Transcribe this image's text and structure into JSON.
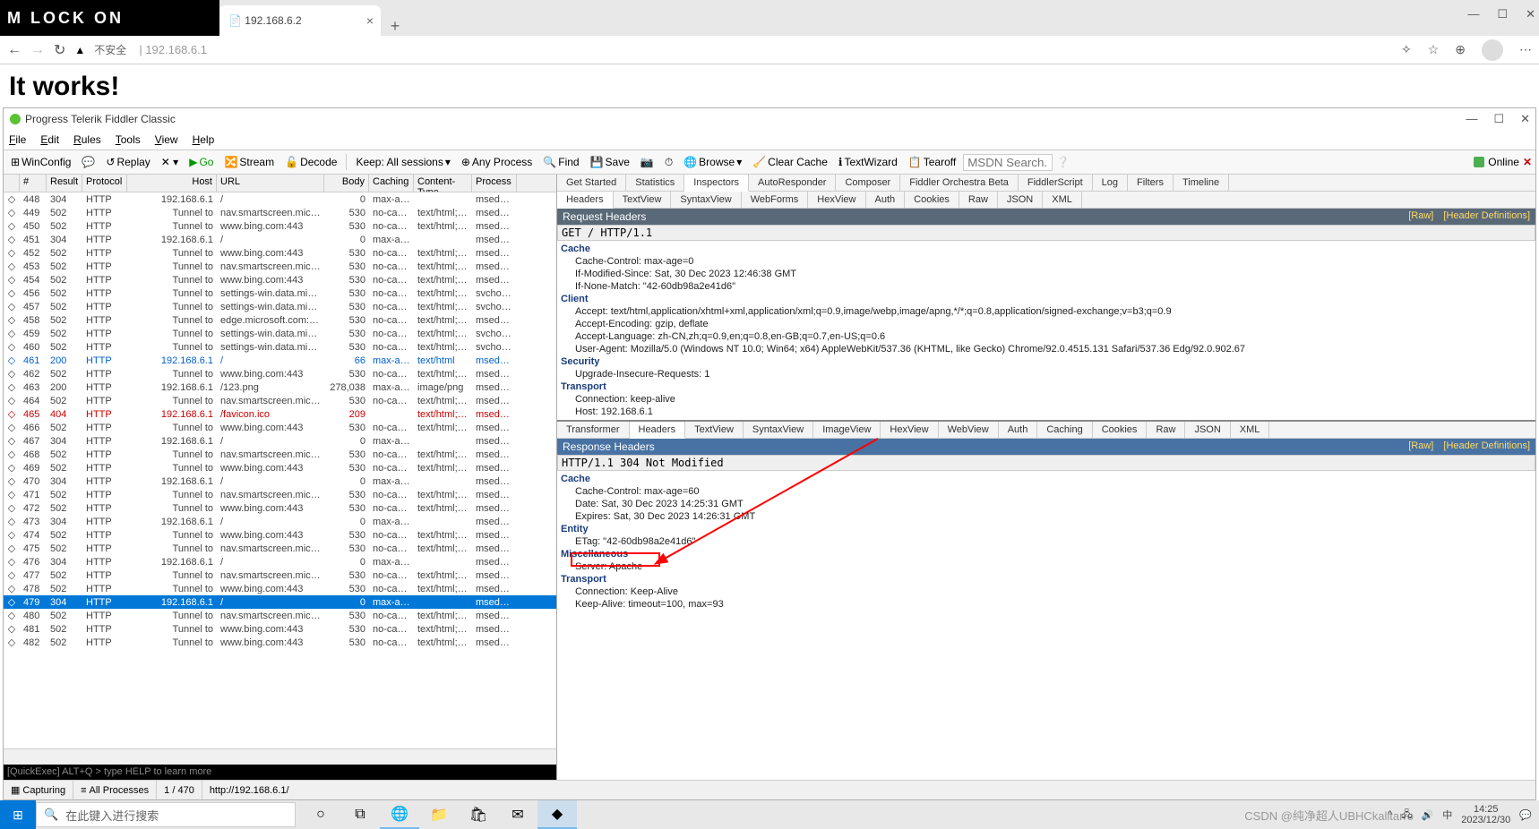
{
  "overlay": {
    "text": "M LOCK ON"
  },
  "edge": {
    "tab_title": "192.168.6.2",
    "addr_warn": "不安全",
    "addr_url": "192.168.6.1",
    "page_h1": "It works!"
  },
  "fiddler": {
    "title": "Progress Telerik Fiddler Classic",
    "menu": [
      "File",
      "Edit",
      "Rules",
      "Tools",
      "View",
      "Help"
    ],
    "toolbar": {
      "winconfig": "WinConfig",
      "replay": "Replay",
      "go": "Go",
      "stream": "Stream",
      "decode": "Decode",
      "keep": "Keep: All sessions",
      "any_process": "Any Process",
      "find": "Find",
      "save": "Save",
      "browse": "Browse",
      "clear_cache": "Clear Cache",
      "textwizard": "TextWizard",
      "tearoff": "Tearoff",
      "search_placeholder": "MSDN Search...",
      "online": "Online"
    },
    "columns": [
      "#",
      "Result",
      "Protocol",
      "Host",
      "URL",
      "Body",
      "Caching",
      "Content-Type",
      "Process"
    ],
    "sessions": [
      {
        "n": "448",
        "r": "304",
        "p": "HTTP",
        "h": "192.168.6.1",
        "u": "/",
        "b": "0",
        "c": "max-ag...",
        "ct": "",
        "pr": "msedg..."
      },
      {
        "n": "449",
        "r": "502",
        "p": "HTTP",
        "h": "Tunnel to",
        "u": "nav.smartscreen.microsof...",
        "b": "530",
        "c": "no-cac...",
        "ct": "text/html; c...",
        "pr": "msedg..."
      },
      {
        "n": "450",
        "r": "502",
        "p": "HTTP",
        "h": "Tunnel to",
        "u": "www.bing.com:443",
        "b": "530",
        "c": "no-cac...",
        "ct": "text/html; c...",
        "pr": "msedg..."
      },
      {
        "n": "451",
        "r": "304",
        "p": "HTTP",
        "h": "192.168.6.1",
        "u": "/",
        "b": "0",
        "c": "max-ag...",
        "ct": "",
        "pr": "msedg..."
      },
      {
        "n": "452",
        "r": "502",
        "p": "HTTP",
        "h": "Tunnel to",
        "u": "www.bing.com:443",
        "b": "530",
        "c": "no-cac...",
        "ct": "text/html; c...",
        "pr": "msedg..."
      },
      {
        "n": "453",
        "r": "502",
        "p": "HTTP",
        "h": "Tunnel to",
        "u": "nav.smartscreen.microsof...",
        "b": "530",
        "c": "no-cac...",
        "ct": "text/html; c...",
        "pr": "msedg..."
      },
      {
        "n": "454",
        "r": "502",
        "p": "HTTP",
        "h": "Tunnel to",
        "u": "www.bing.com:443",
        "b": "530",
        "c": "no-cac...",
        "ct": "text/html; c...",
        "pr": "msedg..."
      },
      {
        "n": "456",
        "r": "502",
        "p": "HTTP",
        "h": "Tunnel to",
        "u": "settings-win.data.microso...",
        "b": "530",
        "c": "no-cac...",
        "ct": "text/html; c...",
        "pr": "svchos..."
      },
      {
        "n": "457",
        "r": "502",
        "p": "HTTP",
        "h": "Tunnel to",
        "u": "settings-win.data.microso...",
        "b": "530",
        "c": "no-cac...",
        "ct": "text/html; c...",
        "pr": "svchos..."
      },
      {
        "n": "458",
        "r": "502",
        "p": "HTTP",
        "h": "Tunnel to",
        "u": "edge.microsoft.com:443",
        "b": "530",
        "c": "no-cac...",
        "ct": "text/html; c...",
        "pr": "msedg..."
      },
      {
        "n": "459",
        "r": "502",
        "p": "HTTP",
        "h": "Tunnel to",
        "u": "settings-win.data.microso...",
        "b": "530",
        "c": "no-cac...",
        "ct": "text/html; c...",
        "pr": "svchos..."
      },
      {
        "n": "460",
        "r": "502",
        "p": "HTTP",
        "h": "Tunnel to",
        "u": "settings-win.data.microso...",
        "b": "530",
        "c": "no-cac...",
        "ct": "text/html; c...",
        "pr": "svchos..."
      },
      {
        "n": "461",
        "r": "200",
        "p": "HTTP",
        "h": "192.168.6.1",
        "u": "/",
        "b": "66",
        "c": "max-ag...",
        "ct": "text/html",
        "pr": "msedg...",
        "cls": "blue"
      },
      {
        "n": "462",
        "r": "502",
        "p": "HTTP",
        "h": "Tunnel to",
        "u": "www.bing.com:443",
        "b": "530",
        "c": "no-cac...",
        "ct": "text/html; c...",
        "pr": "msedg..."
      },
      {
        "n": "463",
        "r": "200",
        "p": "HTTP",
        "h": "192.168.6.1",
        "u": "/123.png",
        "b": "278,038",
        "c": "max-ag...",
        "ct": "image/png",
        "pr": "msedg..."
      },
      {
        "n": "464",
        "r": "502",
        "p": "HTTP",
        "h": "Tunnel to",
        "u": "nav.smartscreen.microsof...",
        "b": "530",
        "c": "no-cac...",
        "ct": "text/html; c...",
        "pr": "msedg..."
      },
      {
        "n": "465",
        "r": "404",
        "p": "HTTP",
        "h": "192.168.6.1",
        "u": "/favicon.ico",
        "b": "209",
        "c": "",
        "ct": "text/html; c...",
        "pr": "msedg...",
        "cls": "red"
      },
      {
        "n": "466",
        "r": "502",
        "p": "HTTP",
        "h": "Tunnel to",
        "u": "www.bing.com:443",
        "b": "530",
        "c": "no-cac...",
        "ct": "text/html; c...",
        "pr": "msedg..."
      },
      {
        "n": "467",
        "r": "304",
        "p": "HTTP",
        "h": "192.168.6.1",
        "u": "/",
        "b": "0",
        "c": "max-ag...",
        "ct": "",
        "pr": "msedg..."
      },
      {
        "n": "468",
        "r": "502",
        "p": "HTTP",
        "h": "Tunnel to",
        "u": "nav.smartscreen.microsof...",
        "b": "530",
        "c": "no-cac...",
        "ct": "text/html; c...",
        "pr": "msedg..."
      },
      {
        "n": "469",
        "r": "502",
        "p": "HTTP",
        "h": "Tunnel to",
        "u": "www.bing.com:443",
        "b": "530",
        "c": "no-cac...",
        "ct": "text/html; c...",
        "pr": "msedg..."
      },
      {
        "n": "470",
        "r": "304",
        "p": "HTTP",
        "h": "192.168.6.1",
        "u": "/",
        "b": "0",
        "c": "max-ag...",
        "ct": "",
        "pr": "msedg..."
      },
      {
        "n": "471",
        "r": "502",
        "p": "HTTP",
        "h": "Tunnel to",
        "u": "nav.smartscreen.microsof...",
        "b": "530",
        "c": "no-cac...",
        "ct": "text/html; c...",
        "pr": "msedg..."
      },
      {
        "n": "472",
        "r": "502",
        "p": "HTTP",
        "h": "Tunnel to",
        "u": "www.bing.com:443",
        "b": "530",
        "c": "no-cac...",
        "ct": "text/html; c...",
        "pr": "msedg..."
      },
      {
        "n": "473",
        "r": "304",
        "p": "HTTP",
        "h": "192.168.6.1",
        "u": "/",
        "b": "0",
        "c": "max-ag...",
        "ct": "",
        "pr": "msedg..."
      },
      {
        "n": "474",
        "r": "502",
        "p": "HTTP",
        "h": "Tunnel to",
        "u": "www.bing.com:443",
        "b": "530",
        "c": "no-cac...",
        "ct": "text/html; c...",
        "pr": "msedg..."
      },
      {
        "n": "475",
        "r": "502",
        "p": "HTTP",
        "h": "Tunnel to",
        "u": "nav.smartscreen.microsof...",
        "b": "530",
        "c": "no-cac...",
        "ct": "text/html; c...",
        "pr": "msedg..."
      },
      {
        "n": "476",
        "r": "304",
        "p": "HTTP",
        "h": "192.168.6.1",
        "u": "/",
        "b": "0",
        "c": "max-ag...",
        "ct": "",
        "pr": "msedg..."
      },
      {
        "n": "477",
        "r": "502",
        "p": "HTTP",
        "h": "Tunnel to",
        "u": "nav.smartscreen.microsof...",
        "b": "530",
        "c": "no-cac...",
        "ct": "text/html; c...",
        "pr": "msedg..."
      },
      {
        "n": "478",
        "r": "502",
        "p": "HTTP",
        "h": "Tunnel to",
        "u": "www.bing.com:443",
        "b": "530",
        "c": "no-cac...",
        "ct": "text/html; c...",
        "pr": "msedg..."
      },
      {
        "n": "479",
        "r": "304",
        "p": "HTTP",
        "h": "192.168.6.1",
        "u": "/",
        "b": "0",
        "c": "max-ag...",
        "ct": "",
        "pr": "msedg...",
        "cls": "selected"
      },
      {
        "n": "480",
        "r": "502",
        "p": "HTTP",
        "h": "Tunnel to",
        "u": "nav.smartscreen.microsof...",
        "b": "530",
        "c": "no-cac...",
        "ct": "text/html; c...",
        "pr": "msedg..."
      },
      {
        "n": "481",
        "r": "502",
        "p": "HTTP",
        "h": "Tunnel to",
        "u": "www.bing.com:443",
        "b": "530",
        "c": "no-cac...",
        "ct": "text/html; c...",
        "pr": "msedg..."
      },
      {
        "n": "482",
        "r": "502",
        "p": "HTTP",
        "h": "Tunnel to",
        "u": "www.bing.com:443",
        "b": "530",
        "c": "no-cac...",
        "ct": "text/html; c...",
        "pr": "msedg..."
      }
    ],
    "quickexec": "[QuickExec] ALT+Q > type HELP to learn more",
    "top_tabs": [
      "Get Started",
      "Statistics",
      "Inspectors",
      "AutoResponder",
      "Composer",
      "Fiddler Orchestra Beta",
      "FiddlerScript",
      "Log",
      "Filters",
      "Timeline"
    ],
    "req_tabs": [
      "Headers",
      "TextView",
      "SyntaxView",
      "WebForms",
      "HexView",
      "Auth",
      "Cookies",
      "Raw",
      "JSON",
      "XML"
    ],
    "resp_tabs": [
      "Transformer",
      "Headers",
      "TextView",
      "SyntaxView",
      "ImageView",
      "HexView",
      "WebView",
      "Auth",
      "Caching",
      "Cookies",
      "Raw",
      "JSON",
      "XML"
    ],
    "req_bar": {
      "title": "Request Headers",
      "raw_link": "[Raw]",
      "def_link": "[Header Definitions]"
    },
    "resp_bar": {
      "title": "Response Headers",
      "raw_link": "[Raw]",
      "def_link": "[Header Definitions]"
    },
    "req_line": "GET / HTTP/1.1",
    "resp_line": "HTTP/1.1 304 Not Modified",
    "req_headers": [
      {
        "g": "Cache"
      },
      {
        "l": "Cache-Control: max-age=0"
      },
      {
        "l": "If-Modified-Since: Sat, 30 Dec 2023 12:46:38 GMT"
      },
      {
        "l": "If-None-Match: \"42-60db98a2e41d6\""
      },
      {
        "g": "Client"
      },
      {
        "l": "Accept: text/html,application/xhtml+xml,application/xml;q=0.9,image/webp,image/apng,*/*;q=0.8,application/signed-exchange;v=b3;q=0.9"
      },
      {
        "l": "Accept-Encoding: gzip, deflate"
      },
      {
        "l": "Accept-Language: zh-CN,zh;q=0.9,en;q=0.8,en-GB;q=0.7,en-US;q=0.6"
      },
      {
        "l": "User-Agent: Mozilla/5.0 (Windows NT 10.0; Win64; x64) AppleWebKit/537.36 (KHTML, like Gecko) Chrome/92.0.4515.131 Safari/537.36 Edg/92.0.902.67"
      },
      {
        "g": "Security"
      },
      {
        "l": "Upgrade-Insecure-Requests: 1"
      },
      {
        "g": "Transport"
      },
      {
        "l": "Connection: keep-alive"
      },
      {
        "l": "Host: 192.168.6.1"
      }
    ],
    "resp_headers": [
      {
        "g": "Cache"
      },
      {
        "l": "Cache-Control: max-age=60"
      },
      {
        "l": "Date: Sat, 30 Dec 2023 14:25:31 GMT"
      },
      {
        "l": "Expires: Sat, 30 Dec 2023 14:26:31 GMT"
      },
      {
        "g": "Entity"
      },
      {
        "l": "ETag: \"42-60db98a2e41d6\""
      },
      {
        "g": "Miscellaneous"
      },
      {
        "l": "Server: Apache",
        "highlight": true
      },
      {
        "g": "Transport"
      },
      {
        "l": "Connection: Keep-Alive"
      },
      {
        "l": "Keep-Alive: timeout=100, max=93"
      }
    ],
    "status": {
      "capturing": "Capturing",
      "processes": "All Processes",
      "count": "1 / 470",
      "url": "http://192.168.6.1/"
    }
  },
  "taskbar": {
    "search_placeholder": "在此键入进行搜索",
    "time": "14:25",
    "date": "2023/12/30"
  },
  "watermark": "CSDN @纯净超人UBHCkalitarro"
}
